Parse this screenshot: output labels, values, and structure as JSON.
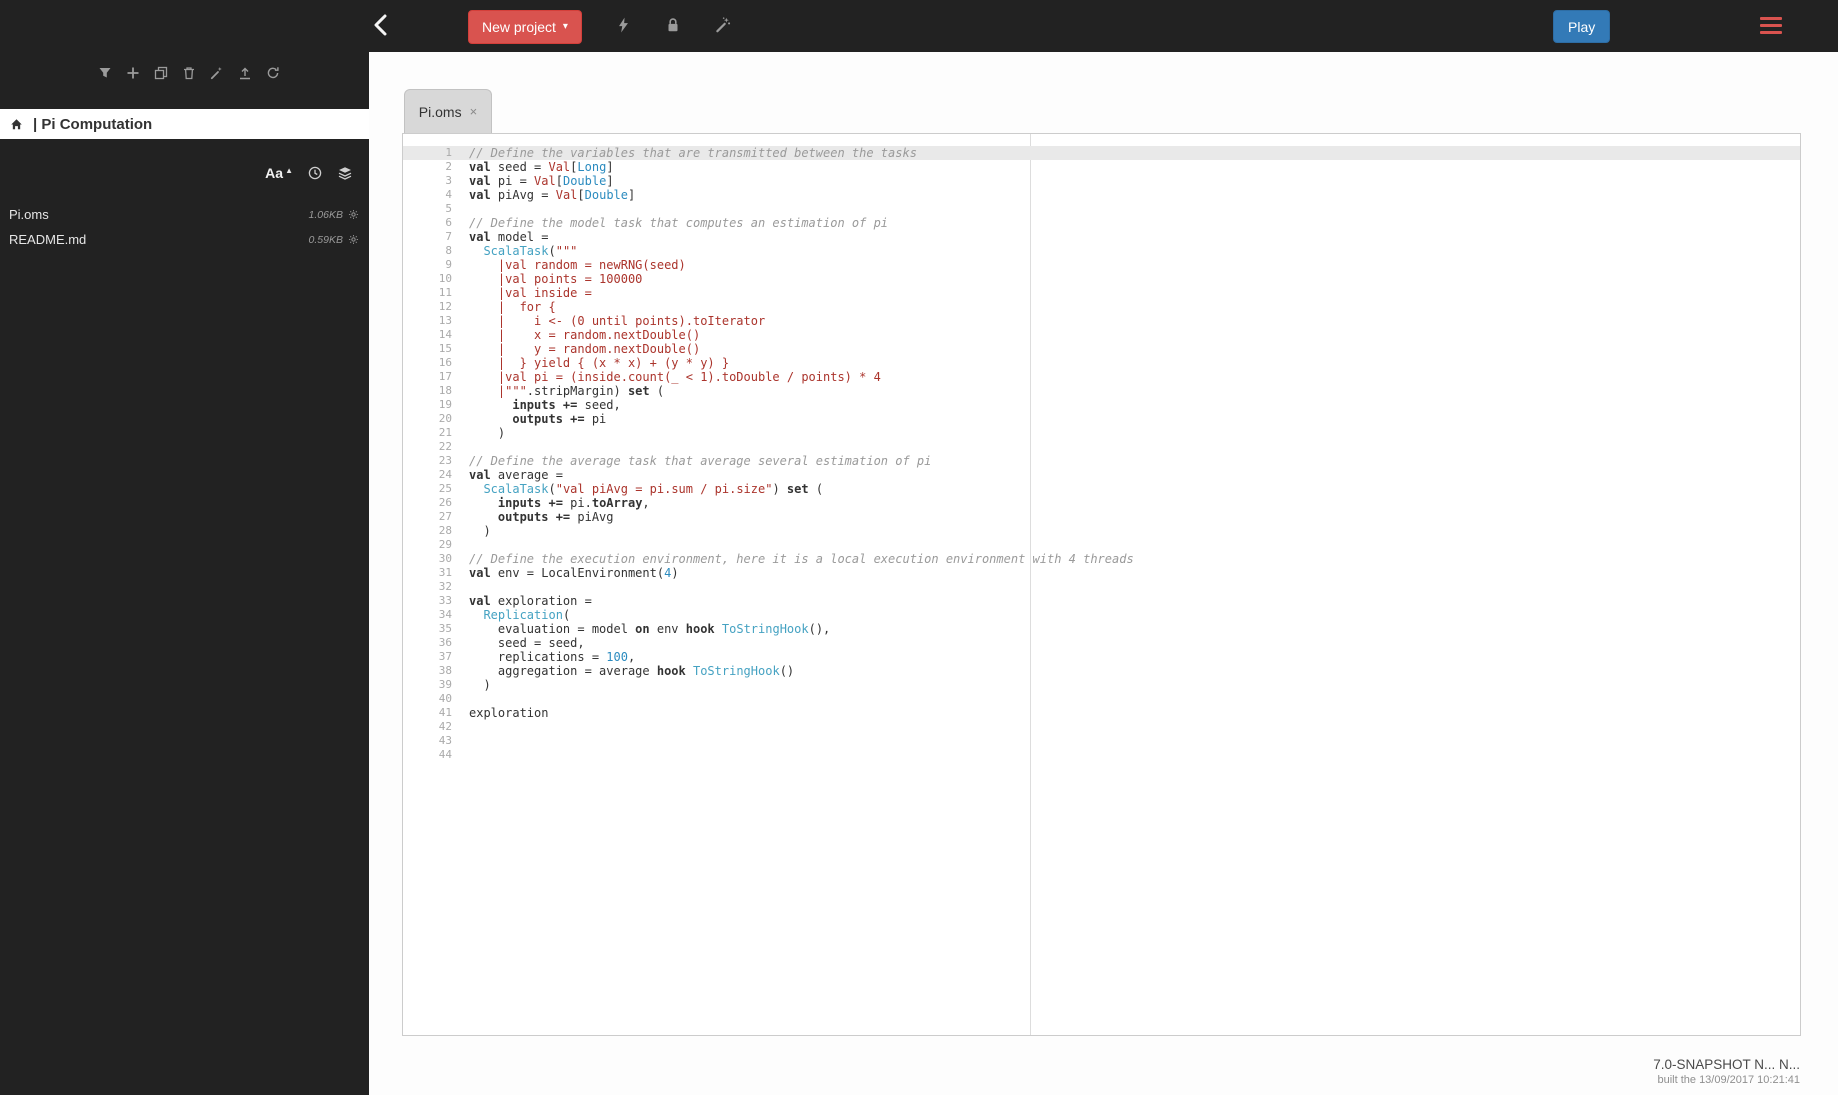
{
  "topbar": {
    "new_project_label": "New project",
    "play_label": "Play"
  },
  "glyphs": {
    "caret_down": "▾",
    "caret_up": "▲",
    "close": "×"
  },
  "sidebar": {
    "project_title": "| Pi Computation",
    "font_control_label": "Aa",
    "files": [
      {
        "name": "Pi.oms",
        "size": "1.06KB"
      },
      {
        "name": "README.md",
        "size": "0.59KB"
      }
    ]
  },
  "editor": {
    "tab_label": "Pi.oms",
    "active_line": 1,
    "lines": [
      [
        [
          "c",
          "// Define the variables that are transmitted between the tasks"
        ]
      ],
      [
        [
          "k",
          "val"
        ],
        [
          "p",
          " seed = "
        ],
        [
          "s",
          "Val"
        ],
        [
          "p",
          "["
        ],
        [
          "b",
          "Long"
        ],
        [
          "p",
          "]"
        ]
      ],
      [
        [
          "k",
          "val"
        ],
        [
          "p",
          " pi = "
        ],
        [
          "s",
          "Val"
        ],
        [
          "p",
          "["
        ],
        [
          "b",
          "Double"
        ],
        [
          "p",
          "]"
        ]
      ],
      [
        [
          "k",
          "val"
        ],
        [
          "p",
          " piAvg = "
        ],
        [
          "s",
          "Val"
        ],
        [
          "p",
          "["
        ],
        [
          "b",
          "Double"
        ],
        [
          "p",
          "]"
        ]
      ],
      [],
      [
        [
          "c",
          "// Define the model task that computes an estimation of pi"
        ]
      ],
      [
        [
          "k",
          "val"
        ],
        [
          "p",
          " model ="
        ]
      ],
      [
        [
          "p",
          "  "
        ],
        [
          "t",
          "ScalaTask"
        ],
        [
          "p",
          "("
        ],
        [
          "s",
          "\"\"\""
        ]
      ],
      [
        [
          "s",
          "    |val random = newRNG(seed)"
        ]
      ],
      [
        [
          "s",
          "    |val points = 100000"
        ]
      ],
      [
        [
          "s",
          "    |val inside ="
        ]
      ],
      [
        [
          "s",
          "    |  for {"
        ]
      ],
      [
        [
          "s",
          "    |    i <- (0 until points).toIterator"
        ]
      ],
      [
        [
          "s",
          "    |    x = random.nextDouble()"
        ]
      ],
      [
        [
          "s",
          "    |    y = random.nextDouble()"
        ]
      ],
      [
        [
          "s",
          "    |  } yield { (x * x) + (y * y) }"
        ]
      ],
      [
        [
          "s",
          "    |val pi = (inside.count(_ < 1).toDouble / points) * 4"
        ]
      ],
      [
        [
          "s",
          "    |\"\"\""
        ],
        [
          "p",
          ".stripMargin) "
        ],
        [
          "k",
          "set"
        ],
        [
          "p",
          " ("
        ]
      ],
      [
        [
          "p",
          "      "
        ],
        [
          "k",
          "inputs +="
        ],
        [
          "p",
          " seed,"
        ]
      ],
      [
        [
          "p",
          "      "
        ],
        [
          "k",
          "outputs +="
        ],
        [
          "p",
          " pi"
        ]
      ],
      [
        [
          "p",
          "    )"
        ]
      ],
      [],
      [
        [
          "c",
          "// Define the average task that average several estimation of pi"
        ]
      ],
      [
        [
          "k",
          "val"
        ],
        [
          "p",
          " average ="
        ]
      ],
      [
        [
          "p",
          "  "
        ],
        [
          "t",
          "ScalaTask"
        ],
        [
          "p",
          "("
        ],
        [
          "s",
          "\"val piAvg = pi.sum / pi.size\""
        ],
        [
          "p",
          ") "
        ],
        [
          "k",
          "set"
        ],
        [
          "p",
          " ("
        ]
      ],
      [
        [
          "p",
          "    "
        ],
        [
          "k",
          "inputs +="
        ],
        [
          "p",
          " pi."
        ],
        [
          "k",
          "toArray"
        ],
        [
          "p",
          ","
        ]
      ],
      [
        [
          "p",
          "    "
        ],
        [
          "k",
          "outputs +="
        ],
        [
          "p",
          " piAvg"
        ]
      ],
      [
        [
          "p",
          "  )"
        ]
      ],
      [],
      [
        [
          "c",
          "// Define the execution environment, here it is a local execution environment with 4 threads"
        ]
      ],
      [
        [
          "k",
          "val"
        ],
        [
          "p",
          " env = LocalEnvironment("
        ],
        [
          "b",
          "4"
        ],
        [
          "p",
          ")"
        ]
      ],
      [],
      [
        [
          "k",
          "val"
        ],
        [
          "p",
          " exploration ="
        ]
      ],
      [
        [
          "p",
          "  "
        ],
        [
          "t",
          "Replication"
        ],
        [
          "p",
          "("
        ]
      ],
      [
        [
          "p",
          "    evaluation = model "
        ],
        [
          "k",
          "on"
        ],
        [
          "p",
          " env "
        ],
        [
          "k",
          "hook"
        ],
        [
          "p",
          " "
        ],
        [
          "t",
          "ToStringHook"
        ],
        [
          "p",
          "(),"
        ]
      ],
      [
        [
          "p",
          "    seed = seed,"
        ]
      ],
      [
        [
          "p",
          "    replications = "
        ],
        [
          "b",
          "100"
        ],
        [
          "p",
          ","
        ]
      ],
      [
        [
          "p",
          "    aggregation = average "
        ],
        [
          "k",
          "hook"
        ],
        [
          "p",
          " "
        ],
        [
          "t",
          "ToStringHook"
        ],
        [
          "p",
          "()"
        ]
      ],
      [
        [
          "p",
          "  )"
        ]
      ],
      [],
      [
        [
          "p",
          "exploration"
        ]
      ],
      [],
      [],
      []
    ]
  },
  "footer": {
    "version": "7.0-SNAPSHOT N... N...",
    "built": "built the 13/09/2017 10:21:41"
  },
  "colors": {
    "accent_red": "#d9534f",
    "accent_blue": "#337ab7",
    "string": "#ab342c",
    "type": "#45a2c2",
    "number": "#2b8bbf",
    "comment": "#9a9a9a",
    "bar_bg": "#222222"
  }
}
